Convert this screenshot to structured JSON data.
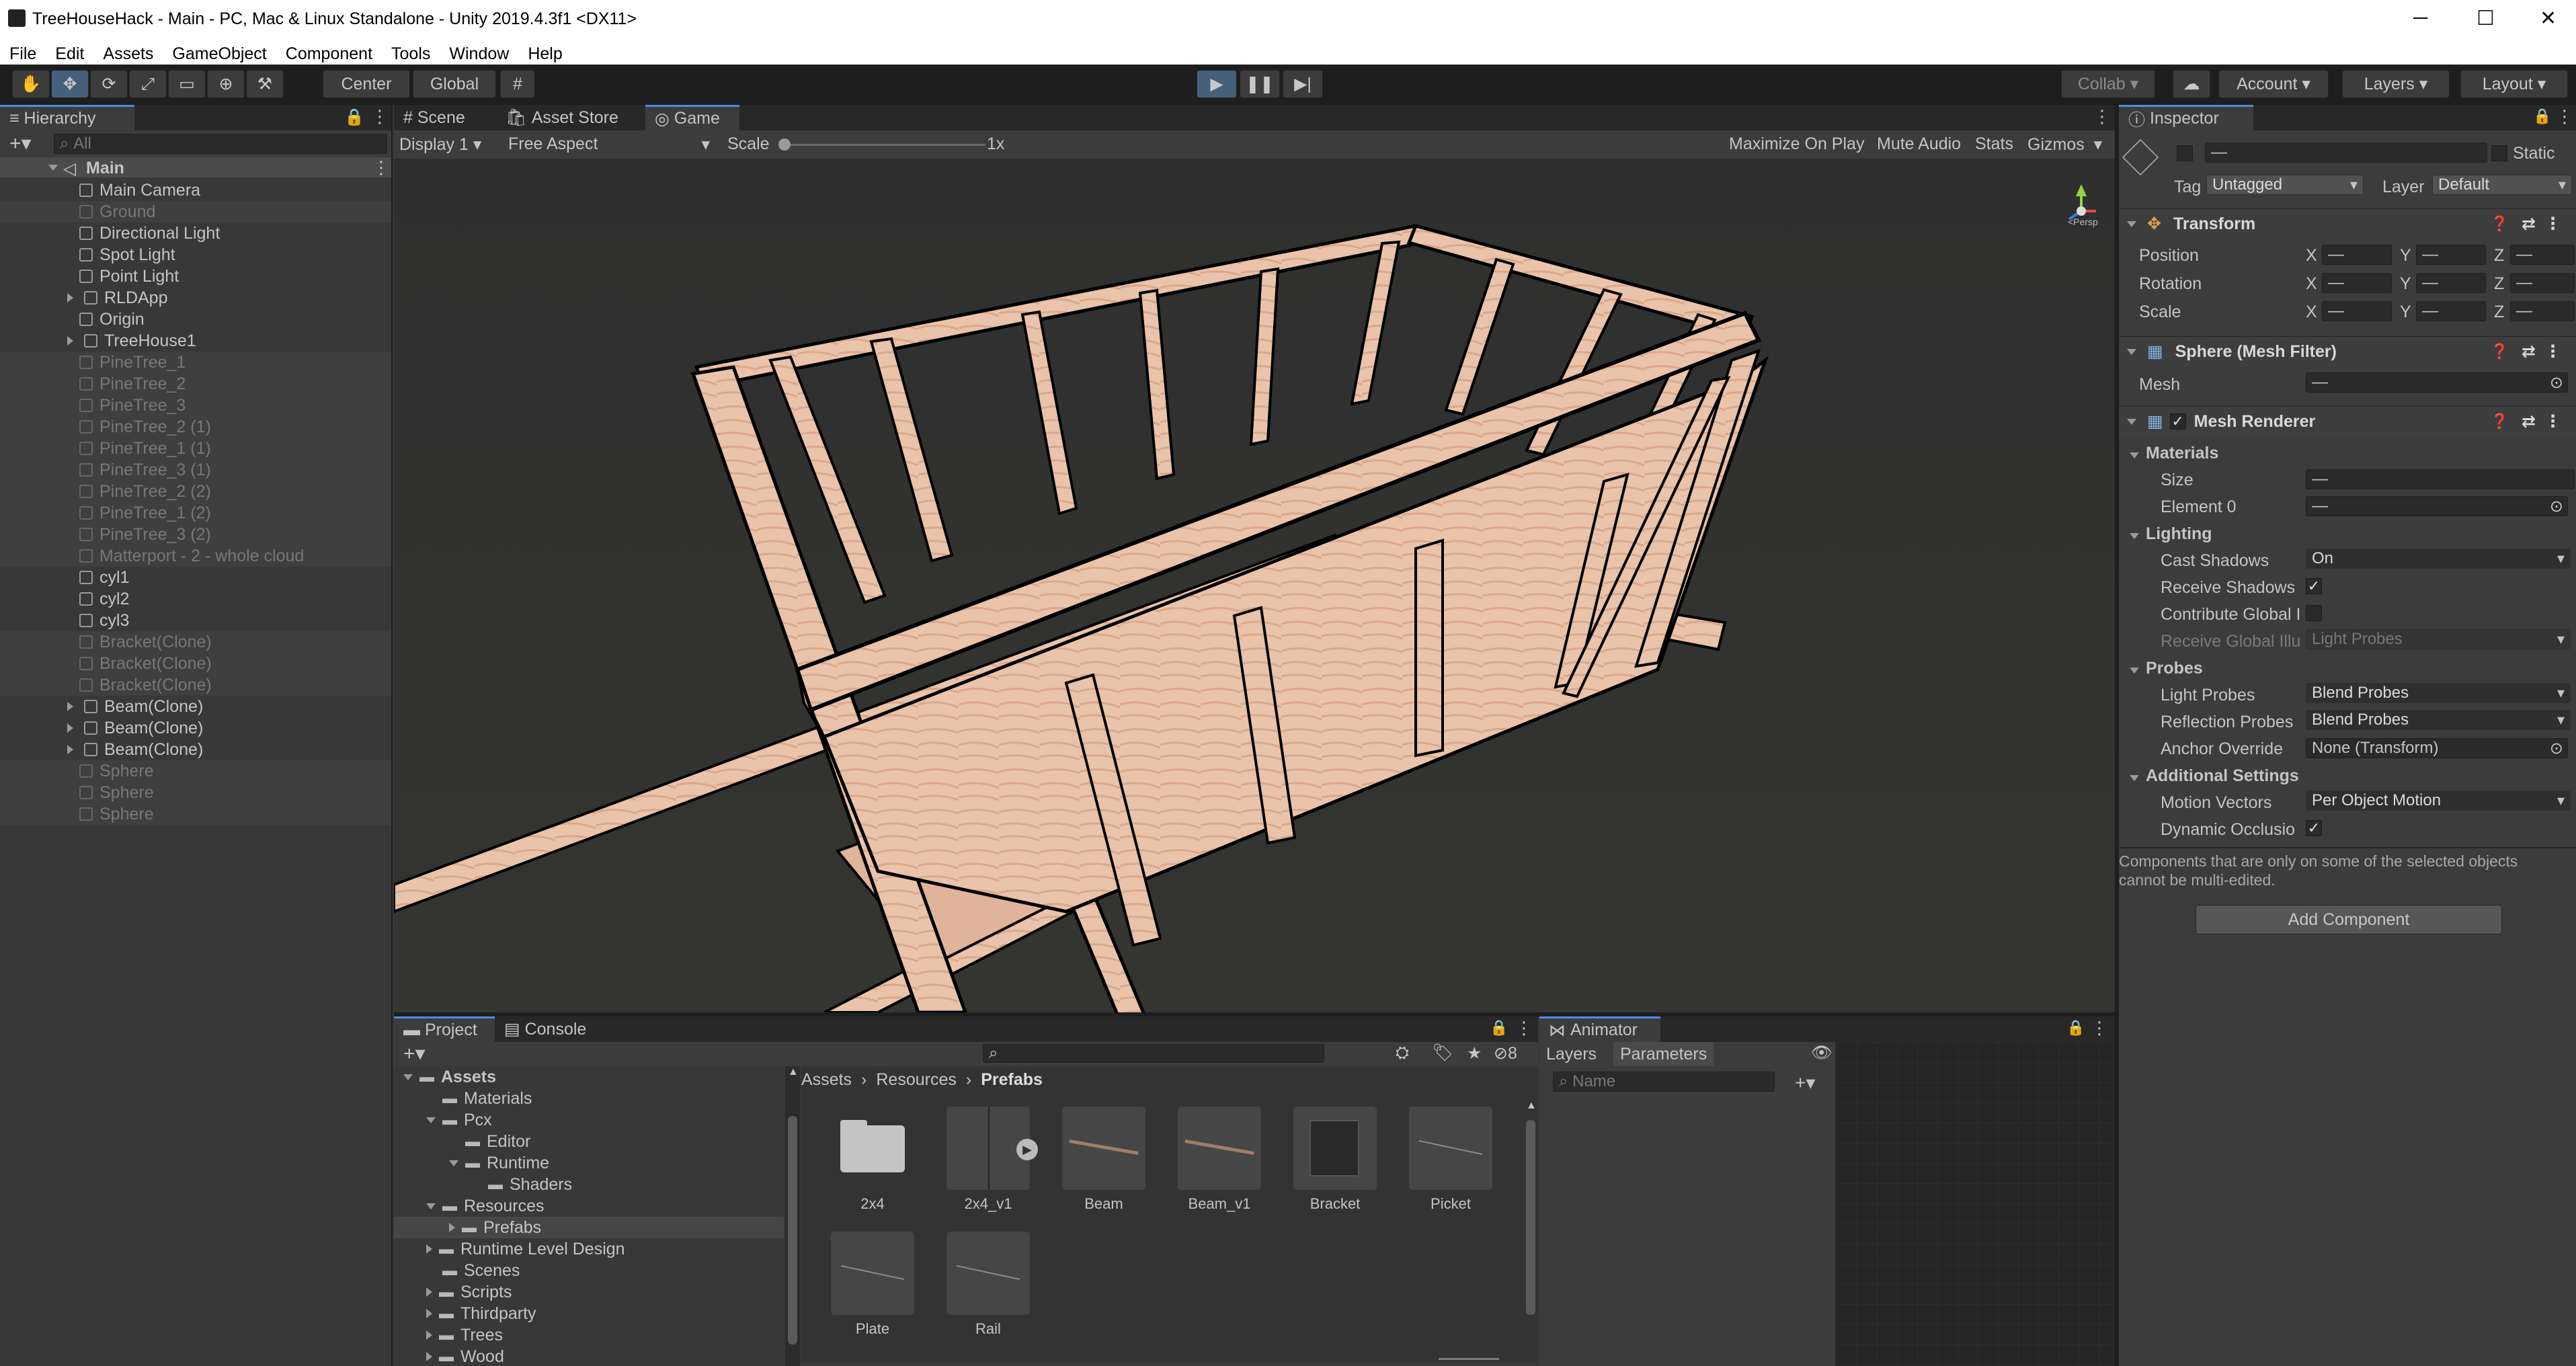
{
  "window": {
    "title": "TreeHouseHack - Main - PC, Mac & Linux Standalone - Unity 2019.4.3f1 <DX11>",
    "controls": [
      "─",
      "☐",
      "✕"
    ]
  },
  "menu": [
    "File",
    "Edit",
    "Assets",
    "GameObject",
    "Component",
    "Tools",
    "Window",
    "Help"
  ],
  "toolbar": {
    "pivot": "Center",
    "space": "Global",
    "collab": "Collab",
    "account": "Account",
    "layers": "Layers",
    "layout": "Layout"
  },
  "hierarchy": {
    "tab": "Hierarchy",
    "search_placeholder": "All",
    "scene": "Main",
    "items": [
      {
        "label": "Main Camera",
        "dim": false,
        "exp": false
      },
      {
        "label": "Ground",
        "dim": true,
        "exp": false
      },
      {
        "label": "Directional Light",
        "dim": false,
        "exp": false
      },
      {
        "label": "Spot Light",
        "dim": false,
        "exp": false
      },
      {
        "label": "Point Light",
        "dim": false,
        "exp": false
      },
      {
        "label": "RLDApp",
        "dim": false,
        "exp": true
      },
      {
        "label": "Origin",
        "dim": false,
        "exp": false
      },
      {
        "label": "TreeHouse1",
        "dim": false,
        "exp": true
      },
      {
        "label": "PineTree_1",
        "dim": true,
        "exp": false
      },
      {
        "label": "PineTree_2",
        "dim": true,
        "exp": false
      },
      {
        "label": "PineTree_3",
        "dim": true,
        "exp": false
      },
      {
        "label": "PineTree_2 (1)",
        "dim": true,
        "exp": false
      },
      {
        "label": "PineTree_1 (1)",
        "dim": true,
        "exp": false
      },
      {
        "label": "PineTree_3 (1)",
        "dim": true,
        "exp": false
      },
      {
        "label": "PineTree_2 (2)",
        "dim": true,
        "exp": false
      },
      {
        "label": "PineTree_1 (2)",
        "dim": true,
        "exp": false
      },
      {
        "label": "PineTree_3 (2)",
        "dim": true,
        "exp": false
      },
      {
        "label": "Matterport - 2 - whole cloud",
        "dim": true,
        "exp": false
      },
      {
        "label": "cyl1",
        "dim": false,
        "exp": false
      },
      {
        "label": "cyl2",
        "dim": false,
        "exp": false
      },
      {
        "label": "cyl3",
        "dim": false,
        "exp": false
      },
      {
        "label": "Bracket(Clone)",
        "dim": true,
        "exp": false
      },
      {
        "label": "Bracket(Clone)",
        "dim": true,
        "exp": false
      },
      {
        "label": "Bracket(Clone)",
        "dim": true,
        "exp": false
      },
      {
        "label": "Beam(Clone)",
        "dim": false,
        "exp": true
      },
      {
        "label": "Beam(Clone)",
        "dim": false,
        "exp": true
      },
      {
        "label": "Beam(Clone)",
        "dim": false,
        "exp": true
      },
      {
        "label": "Sphere",
        "dim": true,
        "exp": false
      },
      {
        "label": "Sphere",
        "dim": true,
        "exp": false
      },
      {
        "label": "Sphere",
        "dim": true,
        "exp": false
      }
    ]
  },
  "viewtabs": {
    "scene": "Scene",
    "asset_store": "Asset Store",
    "game": "Game"
  },
  "gamebar": {
    "display": "Display 1",
    "aspect": "Free Aspect",
    "scale_label": "Scale",
    "scale_value": "1x",
    "maximize": "Maximize On Play",
    "mute": "Mute Audio",
    "stats": "Stats",
    "gizmos": "Gizmos"
  },
  "gizmo_label": "<Persp",
  "inspector": {
    "tab": "Inspector",
    "name": "—",
    "static": "Static",
    "tag_label": "Tag",
    "tag": "Untagged",
    "layer_label": "Layer",
    "layer": "Default",
    "transform": {
      "title": "Transform",
      "position": "Position",
      "rotation": "Rotation",
      "scale": "Scale",
      "x": "X",
      "y": "Y",
      "z": "Z",
      "mixed": "—"
    },
    "mesh_filter": {
      "title": "Sphere (Mesh Filter)",
      "mesh_label": "Mesh",
      "mesh": "—"
    },
    "mesh_renderer": {
      "title": "Mesh Renderer",
      "materials": "Materials",
      "size": "Size",
      "size_value": "—",
      "element0": "Element 0",
      "element0_value": "—",
      "lighting": "Lighting",
      "cast_shadows": "Cast Shadows",
      "cast_shadows_value": "On",
      "receive_shadows": "Receive Shadows",
      "contribute_gi": "Contribute Global I",
      "receive_gi": "Receive Global Illu",
      "receive_gi_value": "Light Probes",
      "probes": "Probes",
      "light_probes": "Light Probes",
      "light_probes_value": "Blend Probes",
      "reflection_probes": "Reflection Probes",
      "reflection_probes_value": "Blend Probes",
      "anchor_override": "Anchor Override",
      "anchor_override_value": "None (Transform)",
      "additional": "Additional Settings",
      "motion_vectors": "Motion Vectors",
      "motion_vectors_value": "Per Object Motion",
      "dynamic_occlusion": "Dynamic Occlusio"
    },
    "note_line1": "Components that are only on some of the selected objects",
    "note_line2": "cannot be multi-edited.",
    "add_component": "Add Component"
  },
  "project": {
    "tab_project": "Project",
    "tab_console": "Console",
    "hidden_count": "8",
    "tree": [
      {
        "label": "Assets",
        "indent": 0,
        "exp": "down",
        "bold": true
      },
      {
        "label": "Materials",
        "indent": 1,
        "exp": "",
        "bold": false
      },
      {
        "label": "Pcx",
        "indent": 1,
        "exp": "down",
        "bold": false
      },
      {
        "label": "Editor",
        "indent": 2,
        "exp": "",
        "bold": false
      },
      {
        "label": "Runtime",
        "indent": 2,
        "exp": "down",
        "bold": false
      },
      {
        "label": "Shaders",
        "indent": 3,
        "exp": "",
        "bold": false
      },
      {
        "label": "Resources",
        "indent": 1,
        "exp": "down",
        "bold": false
      },
      {
        "label": "Prefabs",
        "indent": 2,
        "exp": "right",
        "bold": false
      },
      {
        "label": "Runtime Level Design",
        "indent": 1,
        "exp": "right",
        "bold": false
      },
      {
        "label": "Scenes",
        "indent": 1,
        "exp": "",
        "bold": false
      },
      {
        "label": "Scripts",
        "indent": 1,
        "exp": "right",
        "bold": false
      },
      {
        "label": "Thirdparty",
        "indent": 1,
        "exp": "right",
        "bold": false
      },
      {
        "label": "Trees",
        "indent": 1,
        "exp": "right",
        "bold": false
      },
      {
        "label": "Wood",
        "indent": 1,
        "exp": "right",
        "bold": false
      }
    ],
    "breadcrumb": [
      "Assets",
      "Resources",
      "Prefabs"
    ],
    "assets": [
      {
        "label": "2x4",
        "kind": "folder"
      },
      {
        "label": "2x4_v1",
        "kind": "prefab-play"
      },
      {
        "label": "Beam",
        "kind": "beam"
      },
      {
        "label": "Beam_v1",
        "kind": "beam"
      },
      {
        "label": "Bracket",
        "kind": "cube"
      },
      {
        "label": "Picket",
        "kind": "line"
      },
      {
        "label": "Plate",
        "kind": "line"
      },
      {
        "label": "Rail",
        "kind": "line"
      }
    ]
  },
  "animator": {
    "tab": "Animator",
    "layers": "Layers",
    "parameters": "Parameters",
    "name_placeholder": "Name"
  }
}
